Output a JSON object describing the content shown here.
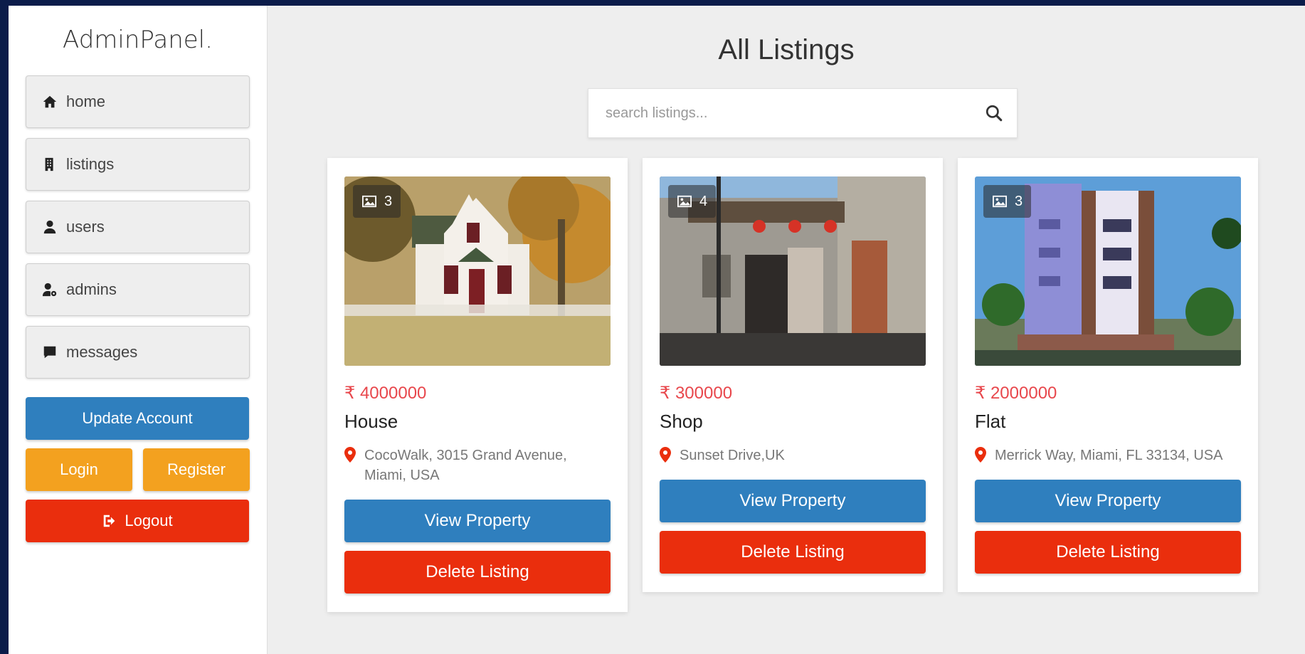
{
  "sidebar": {
    "brand": "AdminPanel.",
    "nav": [
      {
        "label": "home",
        "icon": "home-icon"
      },
      {
        "label": "listings",
        "icon": "building-icon"
      },
      {
        "label": "users",
        "icon": "user-icon"
      },
      {
        "label": "admins",
        "icon": "user-gear-icon"
      },
      {
        "label": "messages",
        "icon": "message-icon"
      }
    ],
    "update_label": "Update Account",
    "login_label": "Login",
    "register_label": "Register",
    "logout_label": "Logout"
  },
  "main": {
    "title": "All Listings",
    "search_placeholder": "search listings...",
    "listings": [
      {
        "image_count": "3",
        "currency": "₹",
        "price": "4000000",
        "name": "House",
        "address": "CocoWalk, 3015 Grand Avenue, Miami, USA",
        "view_label": "View Property",
        "delete_label": "Delete Listing"
      },
      {
        "image_count": "4",
        "currency": "₹",
        "price": "300000",
        "name": "Shop",
        "address": "Sunset Drive,UK",
        "view_label": "View Property",
        "delete_label": "Delete Listing"
      },
      {
        "image_count": "3",
        "currency": "₹",
        "price": "2000000",
        "name": "Flat",
        "address": "Merrick Way, Miami, FL 33134, USA",
        "view_label": "View Property",
        "delete_label": "Delete Listing"
      }
    ]
  },
  "colors": {
    "primary_blue": "#2f7fbe",
    "warning_orange": "#f3a11f",
    "danger_red": "#ea2e0d",
    "price_red": "#e8474c",
    "frame_navy": "#0b1c4a"
  }
}
